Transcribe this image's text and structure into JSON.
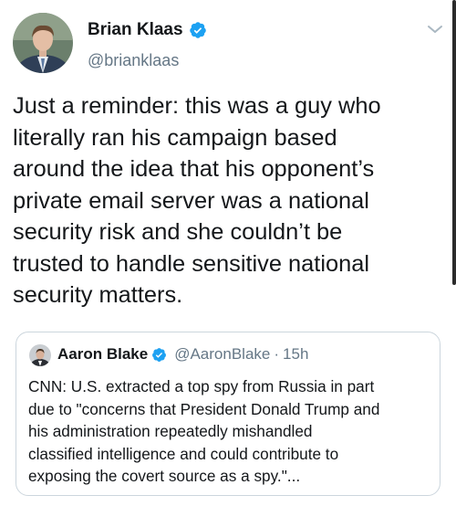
{
  "author": {
    "display_name": "Brian Klaas",
    "handle": "@brianklaas",
    "verified_icon": "verified-badge-icon",
    "avatar_icon": "profile-photo"
  },
  "menu_icon": "chevron-down-icon",
  "tweet": {
    "text": "Just a reminder: this was a guy who\nliterally ran his campaign based\naround the idea that his opponent’s\nprivate email server was a national\nsecurity risk and she couldn’t be\ntrusted to handle sensitive national\nsecurity matters."
  },
  "quoted_tweet": {
    "display_name": "Aaron Blake",
    "handle": "@AaronBlake",
    "separator": "·",
    "time": "15h",
    "text": "CNN: U.S. extracted a top spy from Russia in part\ndue to \"concerns that President Donald Trump and\nhis administration repeatedly mishandled\nclassified intelligence and could contribute to\nexposing the covert source as a spy.\"..."
  },
  "colors": {
    "text_primary": "#14171a",
    "text_secondary": "#657786",
    "verified_blue": "#1da1f2",
    "card_border": "#ccd6dd"
  }
}
